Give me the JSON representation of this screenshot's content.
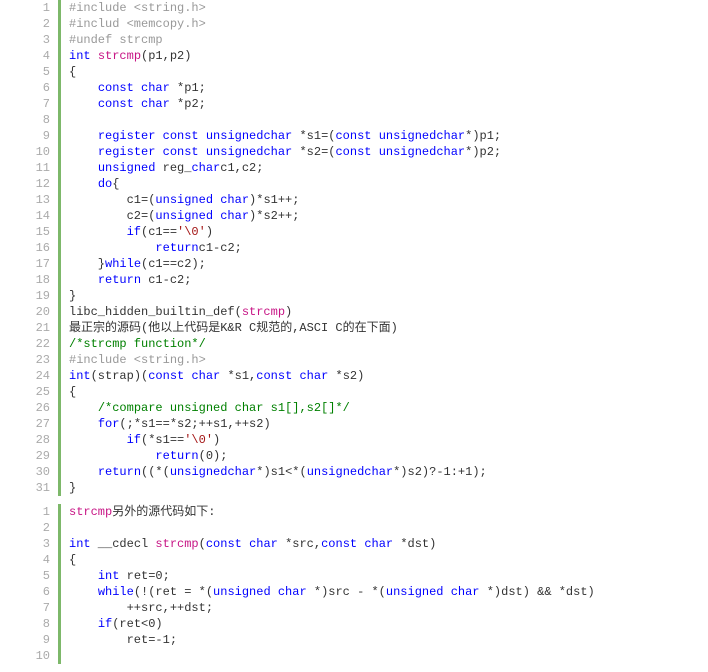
{
  "block1": {
    "lines": [
      {
        "n": "1",
        "segs": [
          {
            "t": "#include <string.h>",
            "c": "pp"
          }
        ]
      },
      {
        "n": "2",
        "segs": [
          {
            "t": "#includ <memcopy.h>",
            "c": "pp"
          }
        ]
      },
      {
        "n": "3",
        "segs": [
          {
            "t": "#undef strcmp",
            "c": "pp"
          }
        ]
      },
      {
        "n": "4",
        "segs": [
          {
            "t": "int",
            "c": "kw"
          },
          {
            "t": " ",
            "c": "txt"
          },
          {
            "t": "strcmp",
            "c": "fn"
          },
          {
            "t": "(p1,p2)",
            "c": "txt"
          }
        ]
      },
      {
        "n": "5",
        "segs": [
          {
            "t": "{",
            "c": "txt"
          }
        ]
      },
      {
        "n": "6",
        "segs": [
          {
            "t": "    ",
            "c": "txt"
          },
          {
            "t": "const",
            "c": "kw"
          },
          {
            "t": " ",
            "c": "txt"
          },
          {
            "t": "char",
            "c": "kw"
          },
          {
            "t": " *p1;",
            "c": "txt"
          }
        ]
      },
      {
        "n": "7",
        "segs": [
          {
            "t": "    ",
            "c": "txt"
          },
          {
            "t": "const",
            "c": "kw"
          },
          {
            "t": " ",
            "c": "txt"
          },
          {
            "t": "char",
            "c": "kw"
          },
          {
            "t": " *p2;",
            "c": "txt"
          }
        ]
      },
      {
        "n": "8",
        "segs": []
      },
      {
        "n": "9",
        "segs": [
          {
            "t": "    ",
            "c": "txt"
          },
          {
            "t": "register",
            "c": "kw"
          },
          {
            "t": " ",
            "c": "txt"
          },
          {
            "t": "const",
            "c": "kw"
          },
          {
            "t": " ",
            "c": "txt"
          },
          {
            "t": "unsigned",
            "c": "kw"
          },
          {
            "t": "char",
            "c": "kw"
          },
          {
            "t": " *s1=(",
            "c": "txt"
          },
          {
            "t": "const",
            "c": "kw"
          },
          {
            "t": " ",
            "c": "txt"
          },
          {
            "t": "unsigned",
            "c": "kw"
          },
          {
            "t": "char",
            "c": "kw"
          },
          {
            "t": "*)p1;",
            "c": "txt"
          }
        ]
      },
      {
        "n": "10",
        "segs": [
          {
            "t": "    ",
            "c": "txt"
          },
          {
            "t": "register",
            "c": "kw"
          },
          {
            "t": " ",
            "c": "txt"
          },
          {
            "t": "const",
            "c": "kw"
          },
          {
            "t": " ",
            "c": "txt"
          },
          {
            "t": "unsigned",
            "c": "kw"
          },
          {
            "t": "char",
            "c": "kw"
          },
          {
            "t": " *s2=(",
            "c": "txt"
          },
          {
            "t": "const",
            "c": "kw"
          },
          {
            "t": " ",
            "c": "txt"
          },
          {
            "t": "unsigned",
            "c": "kw"
          },
          {
            "t": "char",
            "c": "kw"
          },
          {
            "t": "*)p2;",
            "c": "txt"
          }
        ]
      },
      {
        "n": "11",
        "segs": [
          {
            "t": "    ",
            "c": "txt"
          },
          {
            "t": "unsigned",
            "c": "kw"
          },
          {
            "t": " reg_",
            "c": "txt"
          },
          {
            "t": "char",
            "c": "kw"
          },
          {
            "t": "c1,c2;",
            "c": "txt"
          }
        ]
      },
      {
        "n": "12",
        "segs": [
          {
            "t": "    ",
            "c": "txt"
          },
          {
            "t": "do",
            "c": "kw"
          },
          {
            "t": "{",
            "c": "txt"
          }
        ]
      },
      {
        "n": "13",
        "segs": [
          {
            "t": "        c1=(",
            "c": "txt"
          },
          {
            "t": "unsigned",
            "c": "kw"
          },
          {
            "t": " ",
            "c": "txt"
          },
          {
            "t": "char",
            "c": "kw"
          },
          {
            "t": ")*s1++;",
            "c": "txt"
          }
        ]
      },
      {
        "n": "14",
        "segs": [
          {
            "t": "        c2=(",
            "c": "txt"
          },
          {
            "t": "unsigned",
            "c": "kw"
          },
          {
            "t": " ",
            "c": "txt"
          },
          {
            "t": "char",
            "c": "kw"
          },
          {
            "t": ")*s2++;",
            "c": "txt"
          }
        ]
      },
      {
        "n": "15",
        "segs": [
          {
            "t": "        ",
            "c": "txt"
          },
          {
            "t": "if",
            "c": "kw"
          },
          {
            "t": "(c1==",
            "c": "txt"
          },
          {
            "t": "'\\0'",
            "c": "ch"
          },
          {
            "t": ")",
            "c": "txt"
          }
        ]
      },
      {
        "n": "16",
        "segs": [
          {
            "t": "            ",
            "c": "txt"
          },
          {
            "t": "return",
            "c": "kw"
          },
          {
            "t": "c1-c2;",
            "c": "txt"
          }
        ]
      },
      {
        "n": "17",
        "segs": [
          {
            "t": "    }",
            "c": "txt"
          },
          {
            "t": "while",
            "c": "kw"
          },
          {
            "t": "(c1==c2);",
            "c": "txt"
          }
        ]
      },
      {
        "n": "18",
        "segs": [
          {
            "t": "    ",
            "c": "txt"
          },
          {
            "t": "return",
            "c": "kw"
          },
          {
            "t": " c1-c2;",
            "c": "txt"
          }
        ]
      },
      {
        "n": "19",
        "segs": [
          {
            "t": "}",
            "c": "txt"
          }
        ]
      },
      {
        "n": "20",
        "segs": [
          {
            "t": "libc_hidden_builtin_def(",
            "c": "txt"
          },
          {
            "t": "strcmp",
            "c": "fn"
          },
          {
            "t": ")",
            "c": "txt"
          }
        ]
      },
      {
        "n": "21",
        "segs": [
          {
            "t": "最正宗的源码(他以上代码是K&R C规范的,ASCI C的在下面)",
            "c": "txt"
          }
        ]
      },
      {
        "n": "22",
        "segs": [
          {
            "t": "/*strcmp function*/",
            "c": "cm"
          }
        ]
      },
      {
        "n": "23",
        "segs": [
          {
            "t": "#include <string.h>",
            "c": "pp"
          }
        ]
      },
      {
        "n": "24",
        "segs": [
          {
            "t": "int",
            "c": "kw"
          },
          {
            "t": "(strap)(",
            "c": "txt"
          },
          {
            "t": "const",
            "c": "kw"
          },
          {
            "t": " ",
            "c": "txt"
          },
          {
            "t": "char",
            "c": "kw"
          },
          {
            "t": " *s1,",
            "c": "txt"
          },
          {
            "t": "const",
            "c": "kw"
          },
          {
            "t": " ",
            "c": "txt"
          },
          {
            "t": "char",
            "c": "kw"
          },
          {
            "t": " *s2)",
            "c": "txt"
          }
        ]
      },
      {
        "n": "25",
        "segs": [
          {
            "t": "{",
            "c": "txt"
          }
        ]
      },
      {
        "n": "26",
        "segs": [
          {
            "t": "    ",
            "c": "txt"
          },
          {
            "t": "/*compare unsigned char s1[],s2[]*/",
            "c": "cm"
          }
        ]
      },
      {
        "n": "27",
        "segs": [
          {
            "t": "    ",
            "c": "txt"
          },
          {
            "t": "for",
            "c": "kw"
          },
          {
            "t": "(;*s1==*s2;++s1,++s2)",
            "c": "txt"
          }
        ]
      },
      {
        "n": "28",
        "segs": [
          {
            "t": "        ",
            "c": "txt"
          },
          {
            "t": "if",
            "c": "kw"
          },
          {
            "t": "(*s1==",
            "c": "txt"
          },
          {
            "t": "'\\0'",
            "c": "ch"
          },
          {
            "t": ")",
            "c": "txt"
          }
        ]
      },
      {
        "n": "29",
        "segs": [
          {
            "t": "            ",
            "c": "txt"
          },
          {
            "t": "return",
            "c": "kw"
          },
          {
            "t": "(0);",
            "c": "txt"
          }
        ]
      },
      {
        "n": "30",
        "segs": [
          {
            "t": "    ",
            "c": "txt"
          },
          {
            "t": "return",
            "c": "kw"
          },
          {
            "t": "((*(",
            "c": "txt"
          },
          {
            "t": "unsigned",
            "c": "kw"
          },
          {
            "t": "char",
            "c": "kw"
          },
          {
            "t": "*)s1<*(",
            "c": "txt"
          },
          {
            "t": "unsigned",
            "c": "kw"
          },
          {
            "t": "char",
            "c": "kw"
          },
          {
            "t": "*)s2)?-1:+1);",
            "c": "txt"
          }
        ]
      },
      {
        "n": "31",
        "segs": [
          {
            "t": "}",
            "c": "txt"
          }
        ]
      }
    ]
  },
  "block2": {
    "lines": [
      {
        "n": "1",
        "segs": [
          {
            "t": "strcmp",
            "c": "fn"
          },
          {
            "t": "另外的源代码如下:",
            "c": "txt"
          }
        ]
      },
      {
        "n": "2",
        "segs": []
      },
      {
        "n": "3",
        "segs": [
          {
            "t": "int",
            "c": "kw"
          },
          {
            "t": " __cdecl ",
            "c": "txt"
          },
          {
            "t": "strcmp",
            "c": "fn"
          },
          {
            "t": "(",
            "c": "txt"
          },
          {
            "t": "const",
            "c": "kw"
          },
          {
            "t": " ",
            "c": "txt"
          },
          {
            "t": "char",
            "c": "kw"
          },
          {
            "t": " *src,",
            "c": "txt"
          },
          {
            "t": "const",
            "c": "kw"
          },
          {
            "t": " ",
            "c": "txt"
          },
          {
            "t": "char",
            "c": "kw"
          },
          {
            "t": " *dst)",
            "c": "txt"
          }
        ]
      },
      {
        "n": "4",
        "segs": [
          {
            "t": "{",
            "c": "txt"
          }
        ]
      },
      {
        "n": "5",
        "segs": [
          {
            "t": "    ",
            "c": "txt"
          },
          {
            "t": "int",
            "c": "kw"
          },
          {
            "t": " ret=0;",
            "c": "txt"
          }
        ]
      },
      {
        "n": "6",
        "segs": [
          {
            "t": "    ",
            "c": "txt"
          },
          {
            "t": "while",
            "c": "kw"
          },
          {
            "t": "(!(ret = *(",
            "c": "txt"
          },
          {
            "t": "unsigned",
            "c": "kw"
          },
          {
            "t": " ",
            "c": "txt"
          },
          {
            "t": "char",
            "c": "kw"
          },
          {
            "t": " *)src - *(",
            "c": "txt"
          },
          {
            "t": "unsigned",
            "c": "kw"
          },
          {
            "t": " ",
            "c": "txt"
          },
          {
            "t": "char",
            "c": "kw"
          },
          {
            "t": " *)dst) && *dst)",
            "c": "txt"
          }
        ]
      },
      {
        "n": "7",
        "segs": [
          {
            "t": "        ++src,++dst;",
            "c": "txt"
          }
        ]
      },
      {
        "n": "8",
        "segs": [
          {
            "t": "    ",
            "c": "txt"
          },
          {
            "t": "if",
            "c": "kw"
          },
          {
            "t": "(ret<0)",
            "c": "txt"
          }
        ]
      },
      {
        "n": "9",
        "segs": [
          {
            "t": "        ret=-1;",
            "c": "txt"
          }
        ]
      },
      {
        "n": "10",
        "segs": [
          {
            "t": "    ",
            "c": "txt"
          }
        ]
      }
    ]
  }
}
